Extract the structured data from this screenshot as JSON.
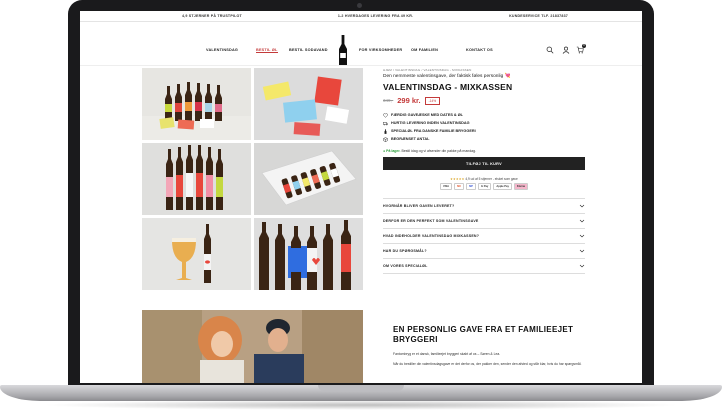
{
  "topbar": {
    "left": "4,9 STJERNER PÅ TRUSTPILOT",
    "center": "1-2 HVERDAGES LEVERING FRA 49 KR.",
    "right": "KUNDESERVICE TLF. 21837837"
  },
  "nav": {
    "items": [
      "VALENTINSDAG",
      "BESTIL ØL",
      "BESTIL SODAVAND",
      "FOR VIRKSOMHEDER",
      "OM FAMILIEN",
      "KONTAKT OS"
    ],
    "active_index": 1,
    "cart_count": "0"
  },
  "product": {
    "breadcrumb": "HJEM / VALENTINSDAG / VALENTINSDAG - MIXKASSEN",
    "subtitle": "Den nemmeste valentinsgave, der faktisk føles personlig 💘",
    "title": "VALENTINSDAG - MIXKASSEN",
    "old_price": "349,-",
    "price": "299 kr.",
    "save": "-14%",
    "features": [
      {
        "icon": "heart-icon",
        "text": "FÆRDIG GAVEÆSKE MED DATES & ØL"
      },
      {
        "icon": "truck-icon",
        "text": "HURTIG LEVERING INDEN VALENTINSDAG"
      },
      {
        "icon": "bottle-icon",
        "text": "SPECIALØL FRA DANSKE FAMILIE BRYGGERI"
      },
      {
        "icon": "box-icon",
        "text": "BEGRÆNSET ANTAL"
      }
    ],
    "stock_label": "På lager.",
    "stock_text": "Bestil idag og vi afsender din pakke på mandag.",
    "cta": "TILFØJ TIL KURV",
    "rating_text": "4,9 ud af 5 stjerner - elsket som gave",
    "payments": [
      "VISA",
      "MC",
      "MP",
      "G Pay",
      "Apple Pay",
      "Klarna"
    ],
    "accordion": [
      "HVORNÅR BLIVER GAVEN LEVERET?",
      "DERFOR ER DEN PERFEKT SOM VALENTINSGAVE",
      "HVAD INDEHOLDER VALENTINSDAG MIXKASSEN?",
      "HAR DU SPØRGSMÅL?",
      "OM VORES SPECIALØL"
    ]
  },
  "story": {
    "title": "EN PERSONLIG GAVE FRA ET FAMILIEEJET BRYGGERI",
    "p1": "Fantombryg er et dansk, familieejet bryggeri skabt af os – Søren & Lea.",
    "p2": "Når du bestiller din valentinsdagsgave er det derfor os, der pakker den, sender den afsted og står klar, hvis du har spørgsmål."
  },
  "colors": {
    "accent": "#c43a3a",
    "cta_bg": "#222222",
    "stock": "#2a9d3a"
  }
}
